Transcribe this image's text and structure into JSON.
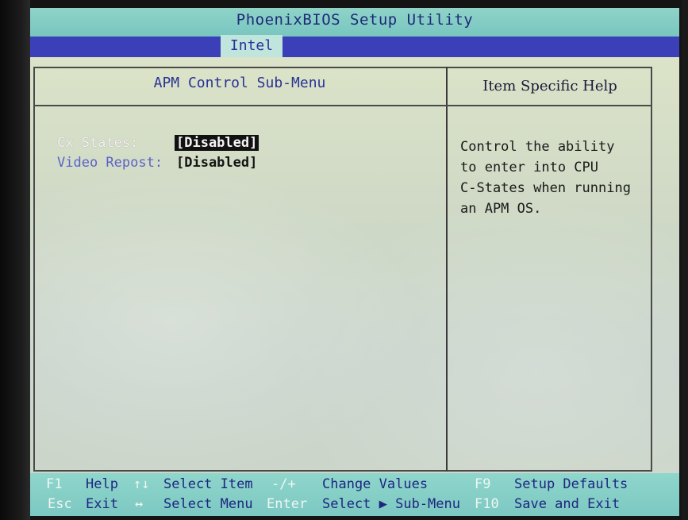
{
  "app": {
    "title": "PhoenixBIOS Setup Utility",
    "active_tab": "Intel"
  },
  "panel": {
    "title": "APM Control Sub-Menu",
    "help_title": "Item Specific Help"
  },
  "settings": [
    {
      "label": "Cx States:",
      "value": "[Disabled]",
      "selected": true
    },
    {
      "label": "Video Repost:",
      "value": "[Disabled]",
      "selected": false
    }
  ],
  "help": {
    "lines": [
      "Control the ability",
      "to enter into CPU",
      "C-States when running",
      "an APM OS."
    ]
  },
  "footer": {
    "f1_key": "F1",
    "f1_desc": "Help",
    "updown_key": "↑↓",
    "updown_desc": "Select Item",
    "minusplus_key": "-/+",
    "minusplus_desc": "Change Values",
    "f9_key": "F9",
    "f9_desc": "Setup Defaults",
    "esc_key": "Esc",
    "esc_desc": "Exit",
    "leftright_key": "↔",
    "leftright_desc": "Select Menu",
    "enter_key": "Enter",
    "enter_desc": "Select ▶ Sub-Menu",
    "f10_key": "F10",
    "f10_desc": "Save and Exit"
  },
  "colors": {
    "title_bar": "#78c6c0",
    "menu_strip": "#3b3fb8",
    "label_blue": "#5a63c8",
    "footer_bg": "#7cc8c2"
  }
}
